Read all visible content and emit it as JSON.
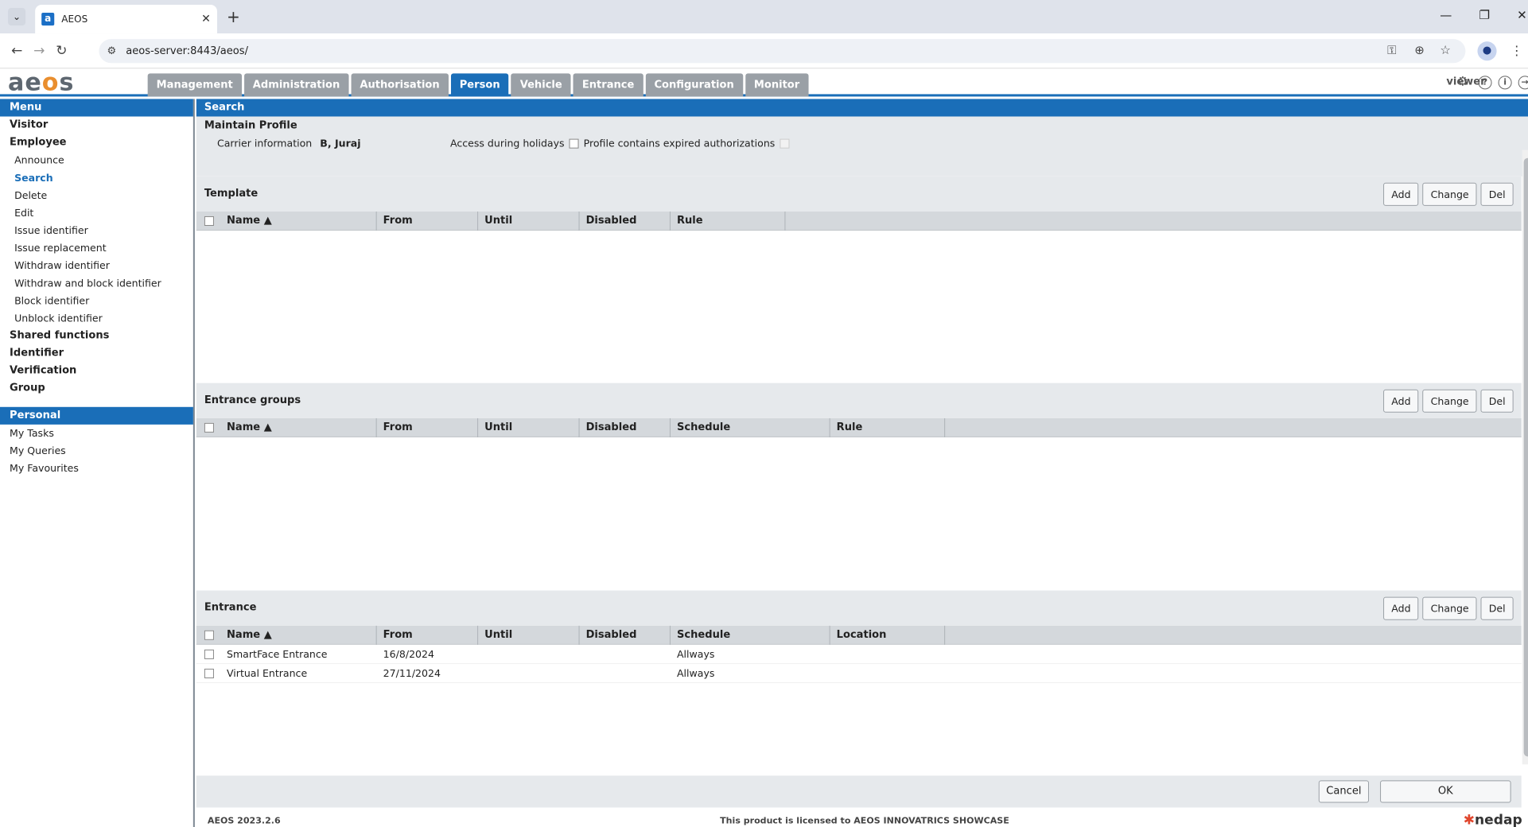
{
  "browser": {
    "tab_title": "AEOS",
    "url": "aeos-server:8443/aeos/"
  },
  "app": {
    "logo": "aeos",
    "nav": [
      "Management",
      "Administration",
      "Authorisation",
      "Person",
      "Vehicle",
      "Entrance",
      "Configuration",
      "Monitor"
    ],
    "active_nav": "Person",
    "user": "viewer"
  },
  "sidebar": {
    "menu_header": "Menu",
    "items": [
      {
        "label": "Visitor",
        "level": "top"
      },
      {
        "label": "Employee",
        "level": "top"
      },
      {
        "label": "Announce",
        "level": "sub"
      },
      {
        "label": "Search",
        "level": "sub",
        "selected": true
      },
      {
        "label": "Delete",
        "level": "sub"
      },
      {
        "label": "Edit",
        "level": "sub"
      },
      {
        "label": "Issue identifier",
        "level": "sub"
      },
      {
        "label": "Issue replacement",
        "level": "sub"
      },
      {
        "label": "Withdraw identifier",
        "level": "sub"
      },
      {
        "label": "Withdraw and block identifier",
        "level": "sub"
      },
      {
        "label": "Block identifier",
        "level": "sub"
      },
      {
        "label": "Unblock identifier",
        "level": "sub"
      },
      {
        "label": "Shared functions",
        "level": "top"
      },
      {
        "label": "Identifier",
        "level": "top"
      },
      {
        "label": "Verification",
        "level": "top"
      },
      {
        "label": "Group",
        "level": "top"
      }
    ],
    "personal_header": "Personal",
    "personal": [
      "My Tasks",
      "My Queries",
      "My Favourites"
    ]
  },
  "main": {
    "header": "Search",
    "profile_title": "Maintain Profile",
    "carrier_label": "Carrier information",
    "carrier_value": "B, Juraj",
    "holidays_label": "Access during holidays",
    "expired_label": "Profile contains expired authorizations",
    "buttons": {
      "add": "Add",
      "change": "Change",
      "del": "Del"
    },
    "template": {
      "title": "Template",
      "columns": [
        "Name ▲",
        "From",
        "Until",
        "Disabled",
        "Rule"
      ],
      "rows": []
    },
    "entrance_groups": {
      "title": "Entrance groups",
      "columns": [
        "Name ▲",
        "From",
        "Until",
        "Disabled",
        "Schedule",
        "Rule"
      ],
      "rows": []
    },
    "entrance": {
      "title": "Entrance",
      "columns": [
        "Name ▲",
        "From",
        "Until",
        "Disabled",
        "Schedule",
        "Location"
      ],
      "rows": [
        {
          "name": "SmartFace Entrance",
          "from": "16/8/2024",
          "until": "",
          "disabled": "",
          "schedule": "Allways",
          "location": ""
        },
        {
          "name": "Virtual Entrance",
          "from": "27/11/2024",
          "until": "",
          "disabled": "",
          "schedule": "Allways",
          "location": ""
        }
      ]
    },
    "cancel": "Cancel",
    "ok": "OK"
  },
  "footer": {
    "version": "AEOS 2023.2.6",
    "license": "This product is licensed to AEOS INNOVATRICS SHOWCASE",
    "brand": "nedap"
  },
  "colors": {
    "accent": "#1a6eb8",
    "logo_orange": "#e98e2e",
    "nav_inactive": "#9aa0a6",
    "section_bg": "#e6e9ec"
  }
}
